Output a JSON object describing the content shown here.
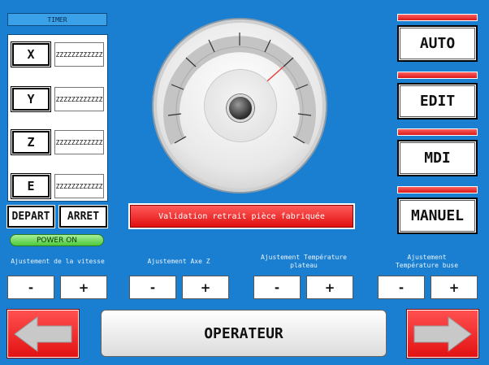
{
  "timer": {
    "label": "TIMER"
  },
  "axes": [
    {
      "label": "X",
      "value": "ZZZZZZZZZZZZ"
    },
    {
      "label": "Y",
      "value": "ZZZZZZZZZZZZ"
    },
    {
      "label": "Z",
      "value": "ZZZZZZZZZZZZ"
    },
    {
      "label": "E",
      "value": "ZZZZZZZZZZZZ"
    }
  ],
  "depart_label": "DEPART",
  "arret_label": "ARRET",
  "power_label": "POWER ON",
  "validation_label": "Validation retrait pièce fabriquée",
  "modes": [
    {
      "label": "AUTO"
    },
    {
      "label": "EDIT"
    },
    {
      "label": "MDI"
    },
    {
      "label": "MANUEL"
    }
  ],
  "adjustments": [
    {
      "label": "Ajustement de la vitesse",
      "minus": "-",
      "plus": "+"
    },
    {
      "label": "Ajustement Axe Z",
      "minus": "-",
      "plus": "+"
    },
    {
      "label": "Ajustement Température plateau",
      "minus": "-",
      "plus": "+"
    },
    {
      "label": "Ajustement Température buse",
      "minus": "-",
      "plus": "+"
    }
  ],
  "operateur_label": "OPERATEUR",
  "icons": {
    "left": "arrow-left-icon",
    "right": "arrow-right-icon"
  },
  "colors": {
    "background": "#1a7fd0",
    "accent_red": "#e21212",
    "power_green": "#4cc83a"
  }
}
